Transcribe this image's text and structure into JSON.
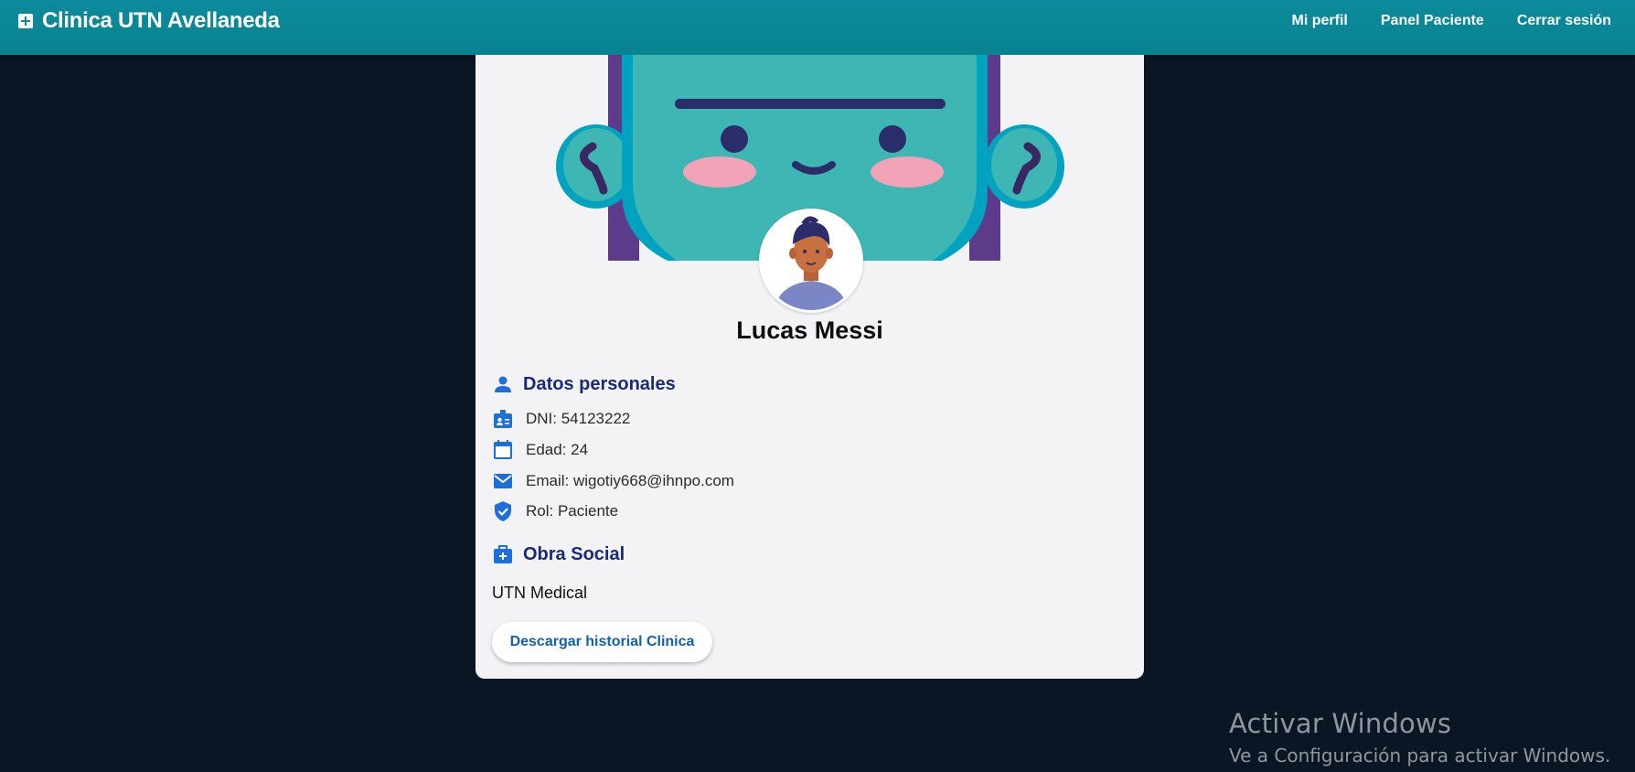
{
  "navbar": {
    "brand_title": "Clinica UTN Avellaneda",
    "links": [
      "Mi perfil",
      "Panel Paciente",
      "Cerrar sesión"
    ]
  },
  "profile": {
    "name": "Lucas Messi",
    "personal_section_title": "Datos personales",
    "dni": "DNI: 54123222",
    "edad": "Edad: 24",
    "email": "Email: wigotiy668@ihnpo.com",
    "rol": "Rol: Paciente",
    "obra_section_title": "Obra Social",
    "obra_social": "UTN Medical",
    "download_button": "Descargar historial Clinica"
  },
  "watermark": {
    "title": "Activar Windows",
    "subtitle": "Ve a Configuración para activar Windows."
  },
  "colors": {
    "navbar": "#0d8a9c",
    "background": "#0b1624",
    "card": "#f3f3f6",
    "section_title": "#1b2a78",
    "icon_blue": "#1f6fd8",
    "button_text": "#1560a8"
  },
  "icons": {
    "brand": "medical-plus-icon",
    "personal": "person-icon",
    "dni": "id-badge-icon",
    "edad": "calendar-icon",
    "email": "mail-icon",
    "rol": "shield-check-icon",
    "obra": "medical-bag-icon"
  }
}
